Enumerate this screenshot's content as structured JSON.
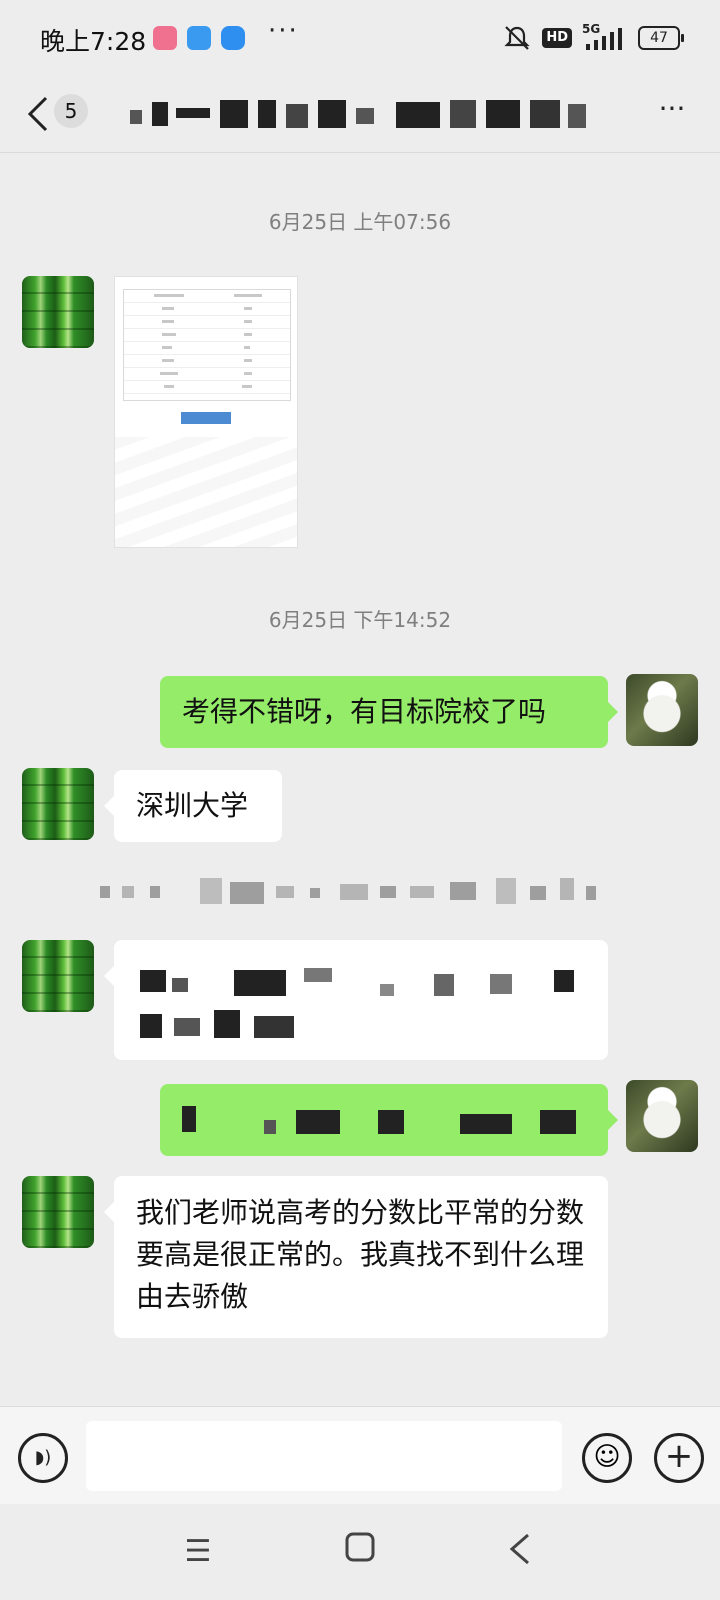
{
  "status_bar": {
    "time": "晚上7:28",
    "network": "5G",
    "hd": "HD",
    "battery": "47"
  },
  "nav": {
    "back_count": "5"
  },
  "messages": {
    "timestamp_1": "6月25日 上午07:56",
    "timestamp_2": "6月25日 下午14:52",
    "sent_1": "考得不错呀，有目标院校了吗",
    "recv_1": "深圳大学",
    "recv_3": "我们老师说高考的分数比平常的分数要高是很正常的。我真找不到什么理由去骄傲"
  },
  "colors": {
    "chat_background": "#ededed",
    "sent_bubble": "#95ec69",
    "received_bubble": "#ffffff"
  },
  "icons": {
    "back": "chevron-left-icon",
    "more": "more-icon",
    "voice": "voice-icon",
    "emoji": "emoji-icon",
    "plus": "plus-icon"
  }
}
